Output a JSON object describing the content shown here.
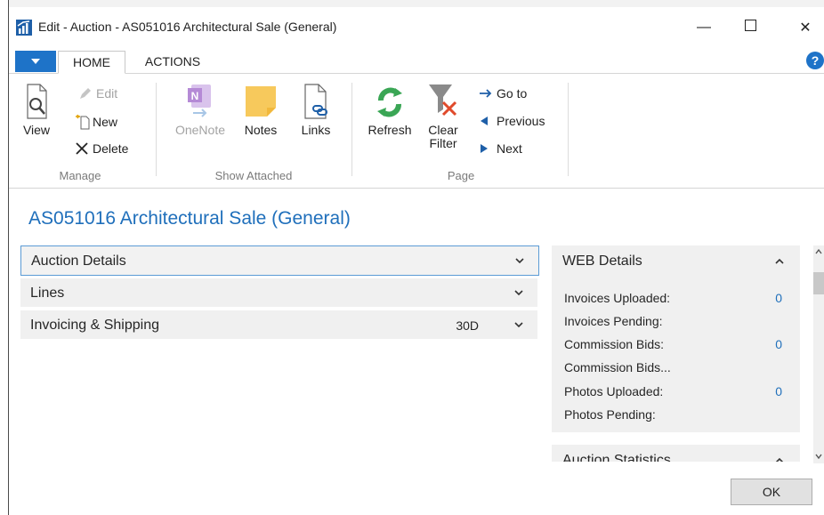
{
  "window": {
    "title": "Edit - Auction - AS051016 Architectural Sale (General)",
    "minimize_glyph": "—",
    "maximize_glyph": "☐",
    "close_glyph": "✕"
  },
  "ribbon_tabs": [
    {
      "label": "HOME",
      "active": true
    },
    {
      "label": "ACTIONS",
      "active": false
    }
  ],
  "ribbon": {
    "manage": {
      "group_label": "Manage",
      "view_label": "View",
      "edit_label": "Edit",
      "new_label": "New",
      "delete_label": "Delete"
    },
    "show_attached": {
      "group_label": "Show Attached",
      "onenote_label": "OneNote",
      "notes_label": "Notes",
      "links_label": "Links"
    },
    "page": {
      "group_label": "Page",
      "refresh_label": "Refresh",
      "clear_filter_line1": "Clear",
      "clear_filter_line2": "Filter",
      "goto_label": "Go to",
      "previous_label": "Previous",
      "next_label": "Next"
    }
  },
  "page_title": "AS051016 Architectural Sale (General)",
  "fasttabs": [
    {
      "label": "Auction Details",
      "value": ""
    },
    {
      "label": "Lines",
      "value": ""
    },
    {
      "label": "Invoicing & Shipping",
      "value": "30D"
    }
  ],
  "web_details": {
    "header": "WEB Details",
    "rows": [
      {
        "label": "Invoices Uploaded:",
        "value": "0"
      },
      {
        "label": "Invoices Pending:",
        "value": ""
      },
      {
        "label": "Commission Bids:",
        "value": "0"
      },
      {
        "label": "Commission Bids...",
        "value": ""
      },
      {
        "label": "Photos Uploaded:",
        "value": "0"
      },
      {
        "label": "Photos Pending:",
        "value": ""
      }
    ]
  },
  "auction_statistics": {
    "header": "Auction Statistics"
  },
  "ok_label": "OK",
  "colors": {
    "accent": "#1e73c8",
    "link_blue": "#1f6fbb",
    "panel_bg": "#f0f0f0",
    "refresh_green": "#3aa655",
    "clear_filter_red": "#e04a2b",
    "notes_yellow": "#f7c95c",
    "onenote_purple": "#b58ad6"
  }
}
